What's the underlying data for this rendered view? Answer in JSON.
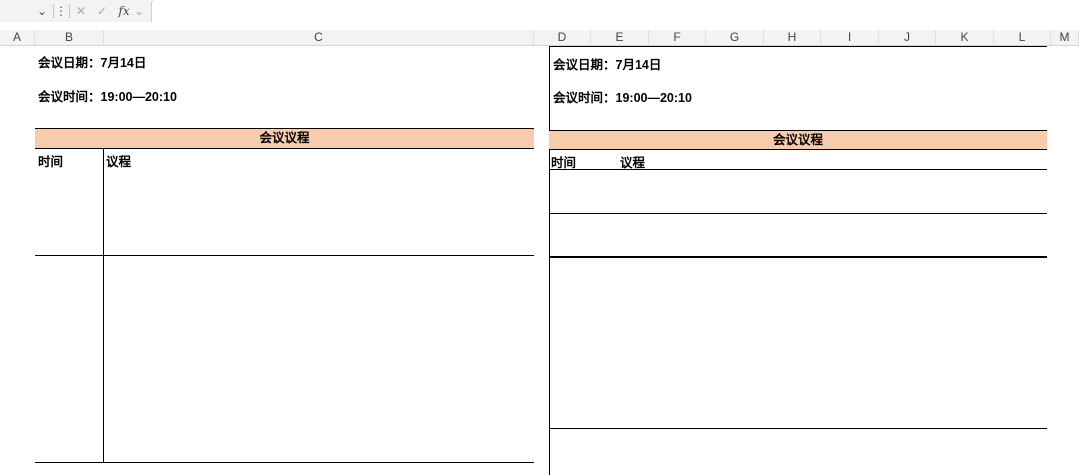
{
  "formula_bar": {
    "name_box_dropdown": "⌄",
    "more": "⋮",
    "cancel": "✕",
    "confirm": "✓",
    "fx": "fx",
    "fx_dropdown": "⌄",
    "value": ""
  },
  "columns": [
    "A",
    "B",
    "C",
    "D",
    "E",
    "F",
    "G",
    "H",
    "I",
    "J",
    "K",
    "L",
    "M"
  ],
  "left_sheet": {
    "date_label": "会议日期：7月14日",
    "time_label": "会议时间：19:00—20:10",
    "agenda_header": "会议议程",
    "col_time": "时间",
    "col_agenda": "议程"
  },
  "right_sheet": {
    "date_label": "会议日期：7月14日",
    "time_label": "会议时间：19:00—20:10",
    "agenda_header": "会议议程",
    "col_time": "时间",
    "col_agenda": "议程"
  },
  "colors": {
    "agenda_band": "#f8cbad",
    "header_bg": "#f3f3f3"
  }
}
